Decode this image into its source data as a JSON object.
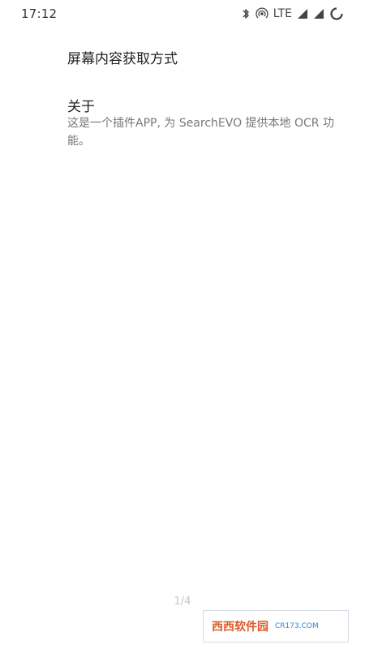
{
  "status_bar": {
    "time": "17:12",
    "network": "LTE",
    "icons": [
      "bluetooth-icon",
      "hotspot-icon",
      "signal-icon",
      "signal-icon-2",
      "battery-ring-icon"
    ]
  },
  "settings": {
    "screen_content_pref_label": "屏幕内容获取方式",
    "about": {
      "title": "关于",
      "description": "这是一个插件APP, 为 SearchEVO 提供本地 OCR 功能。"
    }
  },
  "pager": {
    "text": "1/4"
  },
  "watermark": {
    "brand": "西西软件园",
    "site": "CR173.COM"
  }
}
